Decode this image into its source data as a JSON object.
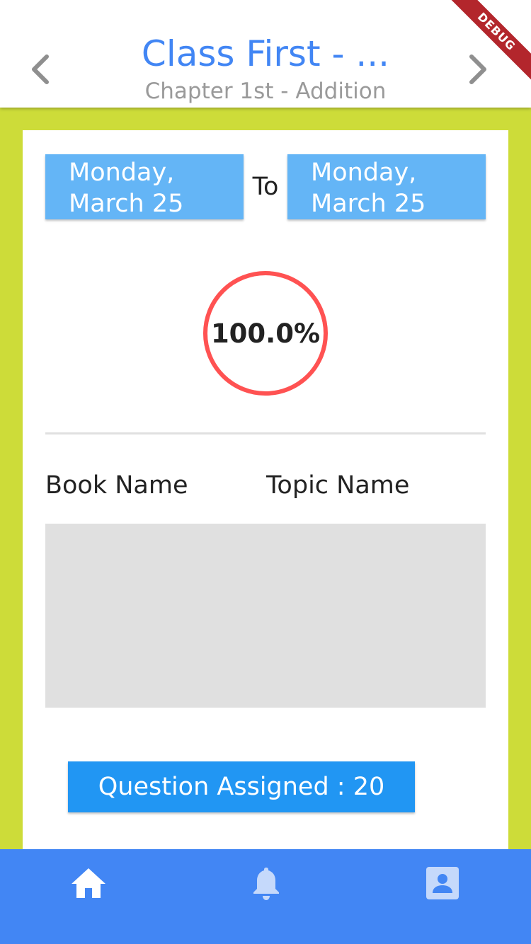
{
  "header": {
    "title": "Class First - ...",
    "subtitle": "Chapter 1st - Addition",
    "prev_icon": "chevron-left-icon",
    "next_icon": "chevron-right-icon",
    "debug_label": "DEBUG"
  },
  "date_range": {
    "from": "Monday,\nMarch 25",
    "separator": "To",
    "to": "Monday,\nMarch 25"
  },
  "progress": {
    "value_percent": 100.0,
    "label": "100.0%",
    "color": "#ff5252"
  },
  "table": {
    "columns": [
      "Book Name",
      "Topic Name"
    ]
  },
  "assigned_button": {
    "label": "Question Assigned : 20"
  },
  "bottom_nav": {
    "items": [
      {
        "icon": "home-icon",
        "active": true
      },
      {
        "icon": "bell-icon",
        "active": false
      },
      {
        "icon": "profile-icon",
        "active": false
      }
    ]
  },
  "colors": {
    "accent": "#4286f4",
    "background": "#cddc39",
    "date_button": "#64b5f6",
    "assigned_button": "#2196f3"
  }
}
